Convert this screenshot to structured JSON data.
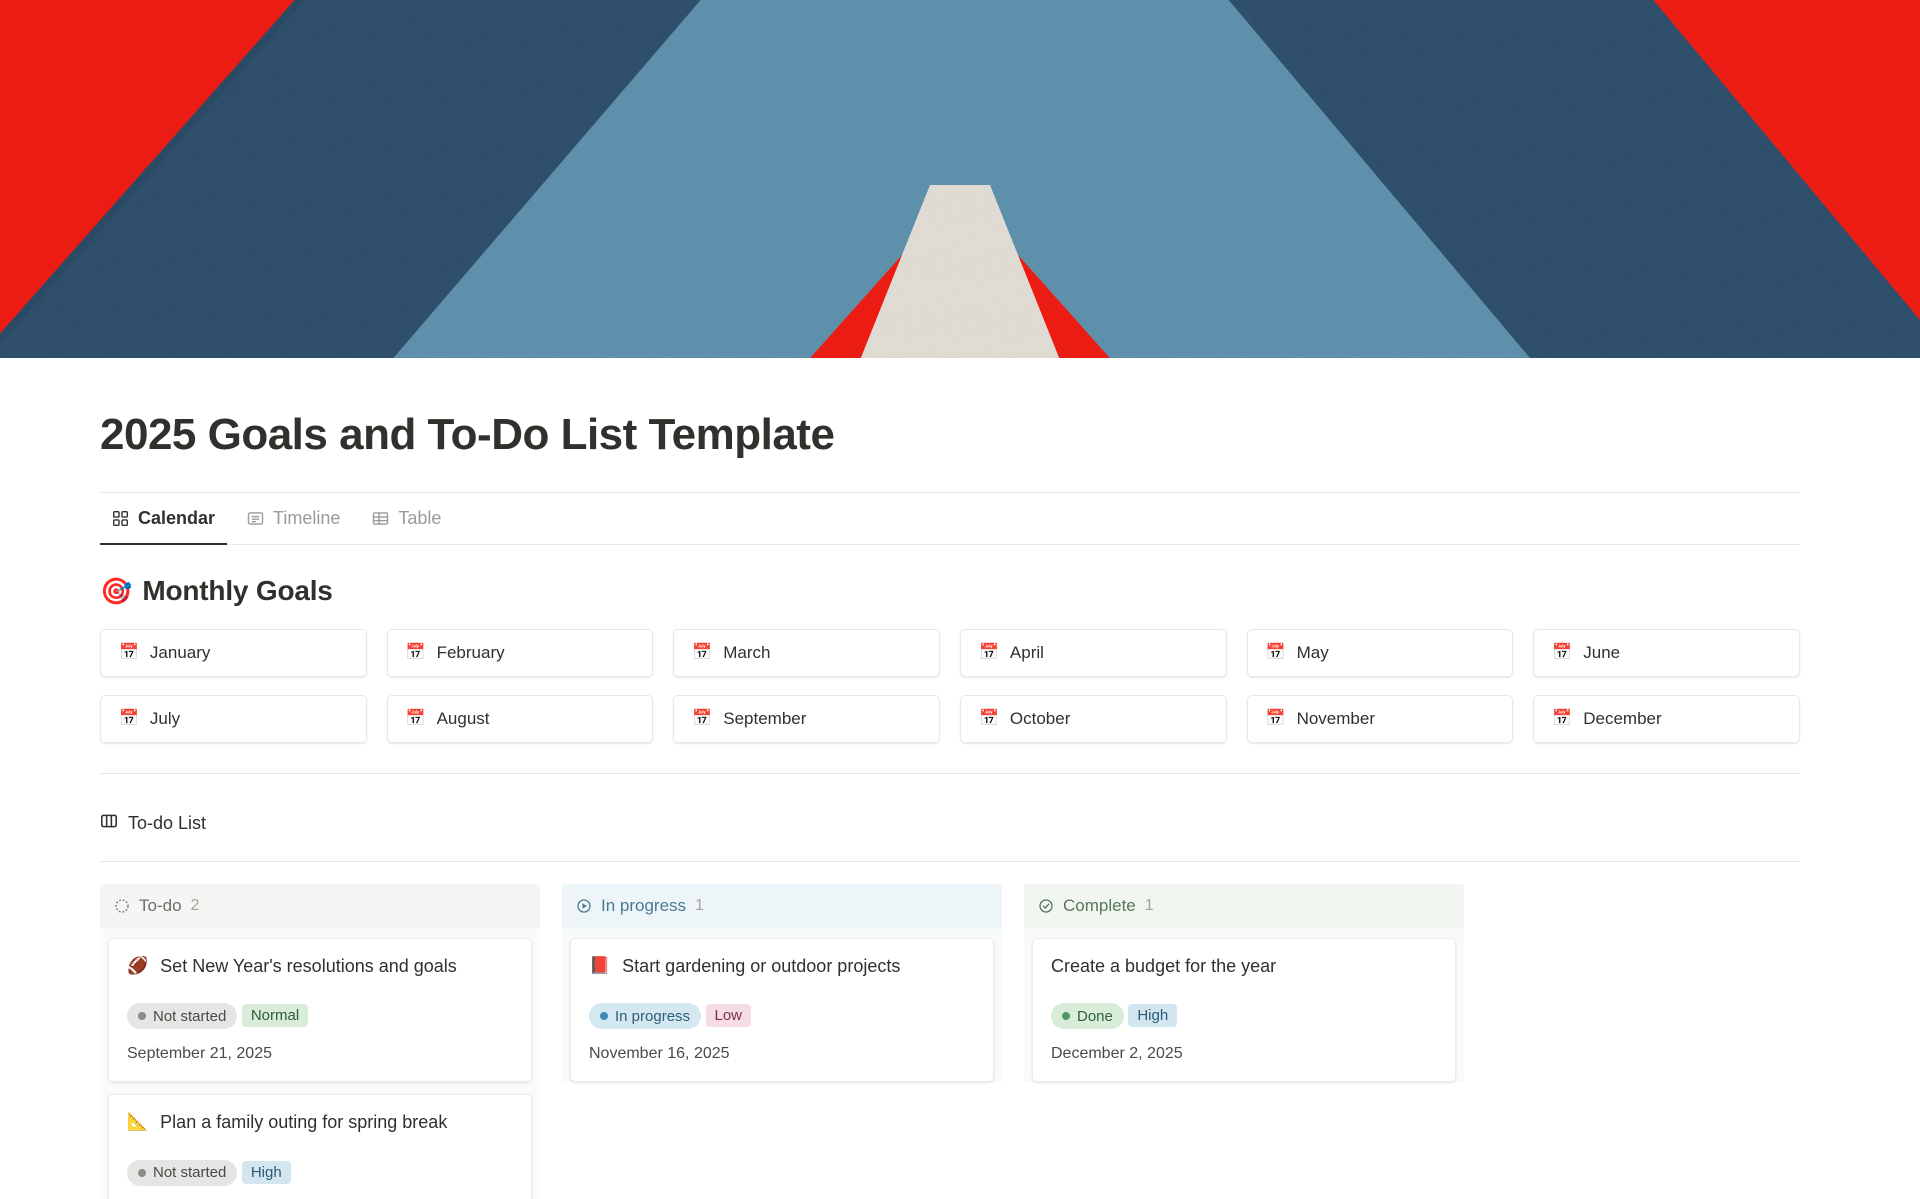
{
  "hero": {
    "name": "paper-chevron-cover",
    "colors": {
      "red": "#ec1c13",
      "navy": "#2e4f6b",
      "blue": "#5e90ac",
      "cream": "#e0dbd3",
      "navy_dark": "#26455f"
    }
  },
  "page": {
    "title": "2025 Goals and To-Do List Template"
  },
  "tabs": [
    {
      "label": "Calendar",
      "icon": "grid-icon",
      "active": true
    },
    {
      "label": "Timeline",
      "icon": "gallery-icon",
      "active": false
    },
    {
      "label": "Table",
      "icon": "table-icon",
      "active": false
    }
  ],
  "monthly_goals": {
    "emoji": "🎯",
    "title": "Monthly Goals",
    "month_emoji": "📅",
    "months": [
      "January",
      "February",
      "March",
      "April",
      "May",
      "June",
      "July",
      "August",
      "September",
      "October",
      "November",
      "December"
    ]
  },
  "todo_list": {
    "icon": "board-icon",
    "title": "To-do List",
    "columns": [
      {
        "key": "todo",
        "name": "To-do",
        "count": "2",
        "icon": "dashed-circle-icon",
        "cards": [
          {
            "emoji": "🏈",
            "title": "Set New Year's resolutions and goals",
            "status": "Not started",
            "status_class": "not-started",
            "priority": "Normal",
            "priority_class": "normal",
            "date": "September 21, 2025"
          },
          {
            "emoji": "📐",
            "title": "Plan a family outing for spring break",
            "status": "Not started",
            "status_class": "not-started",
            "priority": "High",
            "priority_class": "high",
            "date": ""
          }
        ]
      },
      {
        "key": "inprogress",
        "name": "In progress",
        "count": "1",
        "icon": "play-circle-icon",
        "cards": [
          {
            "emoji": "📕",
            "title": "Start gardening or outdoor projects",
            "status": "In progress",
            "status_class": "in-progress",
            "priority": "Low",
            "priority_class": "low",
            "date": "November 16, 2025"
          }
        ]
      },
      {
        "key": "complete",
        "name": "Complete",
        "count": "1",
        "icon": "check-circle-icon",
        "cards": [
          {
            "emoji": "",
            "title": "Create a budget for the year",
            "status": "Done",
            "status_class": "done",
            "priority": "High",
            "priority_class": "high",
            "date": "December 2, 2025"
          }
        ]
      }
    ]
  }
}
